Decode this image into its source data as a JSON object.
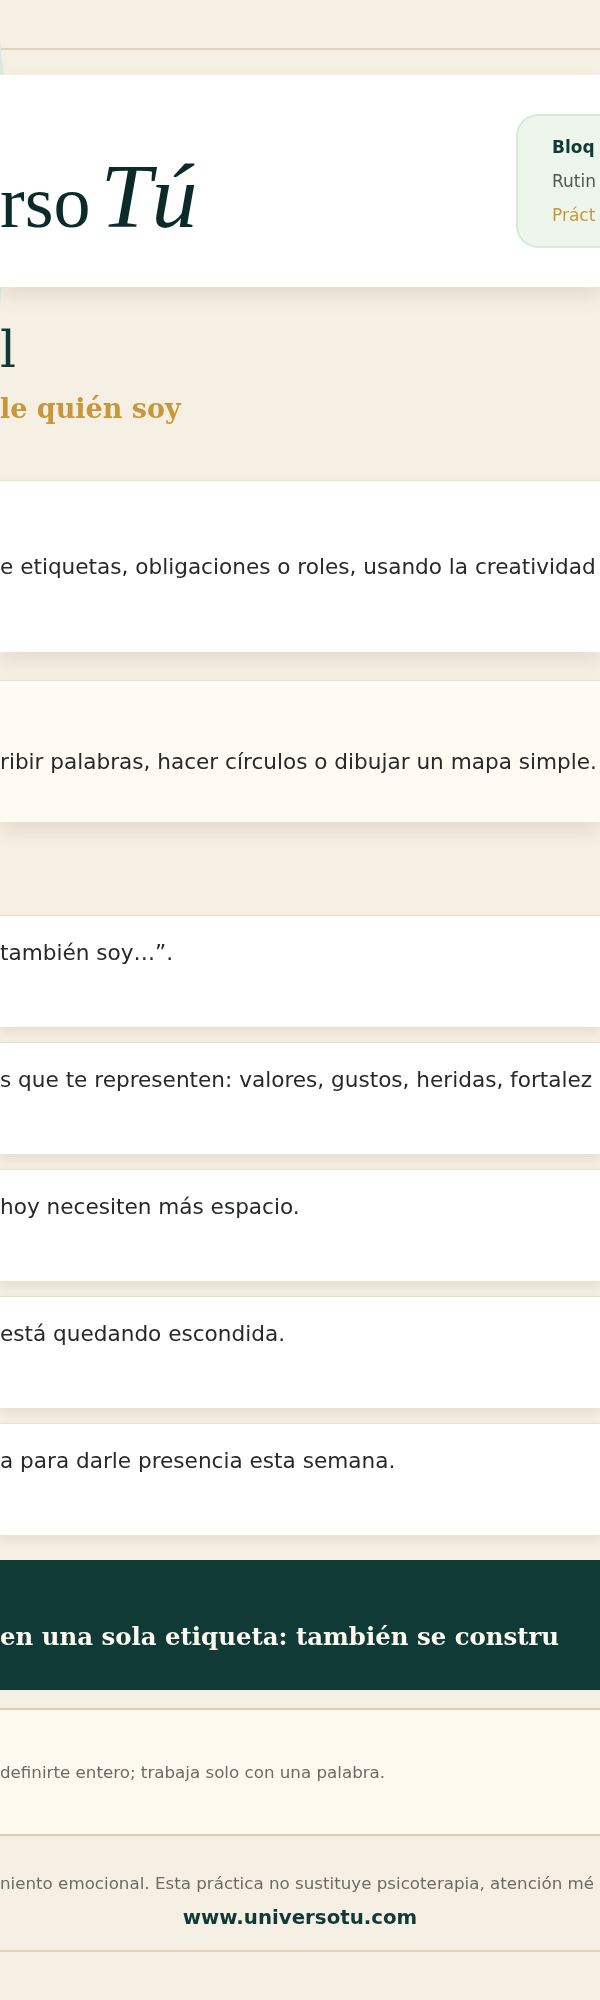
{
  "header": {
    "logo": {
      "wordmark": "rso",
      "script": "Tú"
    },
    "badge": {
      "title": "Bloq",
      "line": "Rutin",
      "tag": "Práct"
    }
  },
  "heading": {
    "title": "l",
    "subtitle": "le quién soy"
  },
  "intro": {
    "text": "e etiquetas, obligaciones o roles, usando la creatividad"
  },
  "hint": {
    "text": "ribir palabras, hacer círculos o dibujar un mapa simple."
  },
  "steps": [
    {
      "text": "también soy…”."
    },
    {
      "text": "s que te representen: valores, gustos, heridas, fortalez"
    },
    {
      "text": "hoy necesiten más espacio."
    },
    {
      "text": "está quedando escondida."
    },
    {
      "text": "a para darle presencia esta semana."
    }
  ],
  "banner": {
    "text": "en una sola etiqueta: también se constru"
  },
  "note": {
    "text": "definirte entero; trabaja solo con una palabra."
  },
  "footer": {
    "disclaimer": "niento emocional. Esta práctica no sustituye psicoterapia, atención mé",
    "link": "www.universotu.com"
  }
}
